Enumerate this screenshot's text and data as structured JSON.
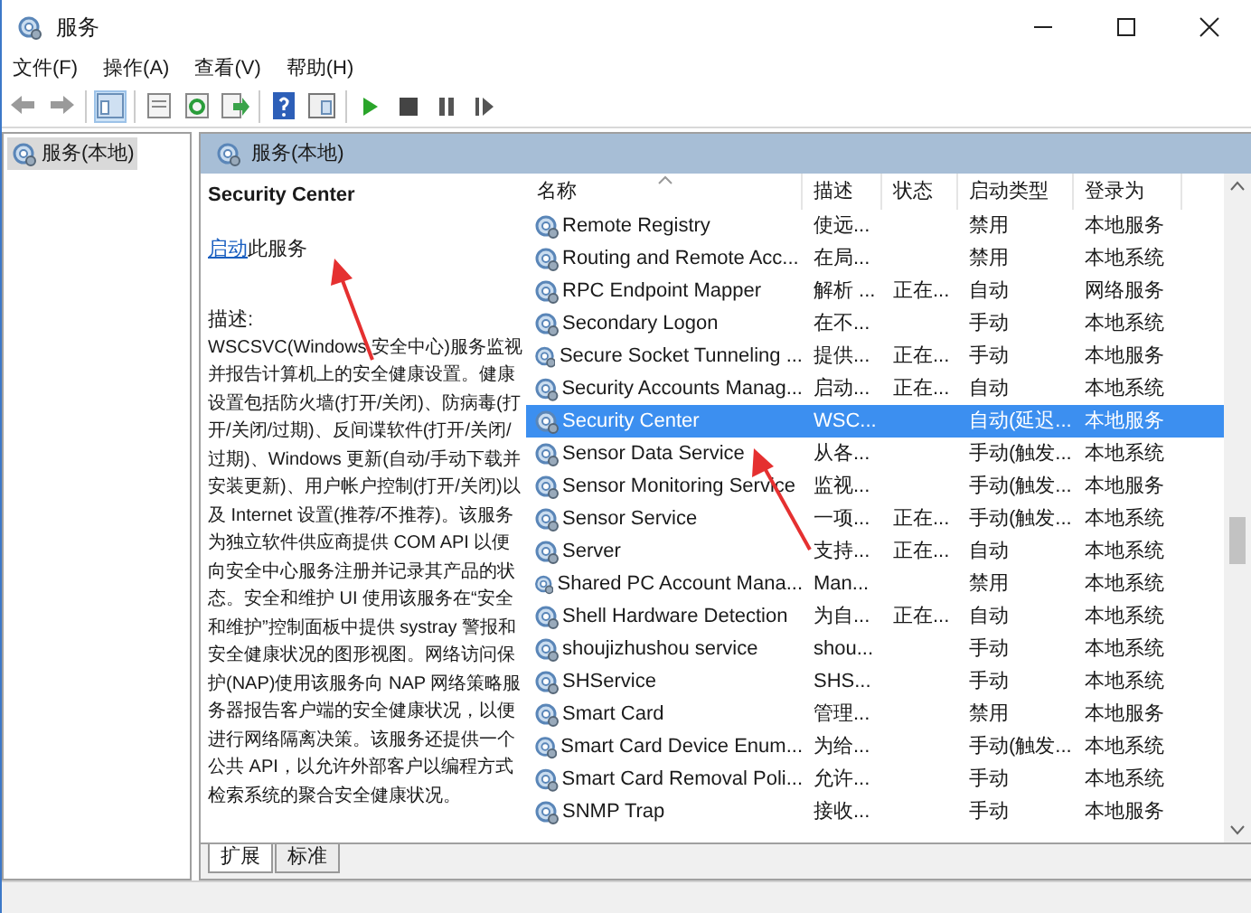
{
  "window": {
    "title": "服务"
  },
  "menu": [
    "文件(F)",
    "操作(A)",
    "查看(V)",
    "帮助(H)"
  ],
  "tree": {
    "items": [
      {
        "label": "服务(本地)",
        "selected": true
      }
    ]
  },
  "panel_header": "服务(本地)",
  "detail": {
    "title": "Security Center",
    "action_link": "启动",
    "action_text": "此服务",
    "description_label": "描述:",
    "description": "WSCSVC(Windows 安全中心)服务监视并报告计算机上的安全健康设置。健康设置包括防火墙(打开/关闭)、防病毒(打开/关闭/过期)、反间谍软件(打开/关闭/过期)、Windows 更新(自动/手动下载并安装更新)、用户帐户控制(打开/关闭)以及 Internet 设置(推荐/不推荐)。该服务为独立软件供应商提供 COM API 以便向安全中心服务注册并记录其产品的状态。安全和维护 UI 使用该服务在“安全和维护”控制面板中提供 systray 警报和安全健康状况的图形视图。网络访问保护(NAP)使用该服务向 NAP 网络策略服务器报告客户端的安全健康状况，以便进行网络隔离决策。该服务还提供一个公共 API，以允许外部客户以编程方式检索系统的聚合安全健康状况。"
  },
  "table": {
    "columns": [
      "名称",
      "描述",
      "状态",
      "启动类型",
      "登录为"
    ],
    "rows": [
      {
        "name": "Remote Registry",
        "desc": "使远...",
        "status": "",
        "startup": "禁用",
        "logon": "本地服务",
        "selected": false
      },
      {
        "name": "Routing and Remote Acc...",
        "desc": "在局...",
        "status": "",
        "startup": "禁用",
        "logon": "本地系统",
        "selected": false
      },
      {
        "name": "RPC Endpoint Mapper",
        "desc": "解析 ...",
        "status": "正在...",
        "startup": "自动",
        "logon": "网络服务",
        "selected": false
      },
      {
        "name": "Secondary Logon",
        "desc": "在不...",
        "status": "",
        "startup": "手动",
        "logon": "本地系统",
        "selected": false
      },
      {
        "name": "Secure Socket Tunneling ...",
        "desc": "提供...",
        "status": "正在...",
        "startup": "手动",
        "logon": "本地服务",
        "selected": false
      },
      {
        "name": "Security Accounts Manag...",
        "desc": "启动...",
        "status": "正在...",
        "startup": "自动",
        "logon": "本地系统",
        "selected": false
      },
      {
        "name": "Security Center",
        "desc": "WSC...",
        "status": "",
        "startup": "自动(延迟...",
        "logon": "本地服务",
        "selected": true
      },
      {
        "name": "Sensor Data Service",
        "desc": "从各...",
        "status": "",
        "startup": "手动(触发...",
        "logon": "本地系统",
        "selected": false
      },
      {
        "name": "Sensor Monitoring Service",
        "desc": "监视...",
        "status": "",
        "startup": "手动(触发...",
        "logon": "本地服务",
        "selected": false
      },
      {
        "name": "Sensor Service",
        "desc": "一项...",
        "status": "正在...",
        "startup": "手动(触发...",
        "logon": "本地系统",
        "selected": false
      },
      {
        "name": "Server",
        "desc": "支持...",
        "status": "正在...",
        "startup": "自动",
        "logon": "本地系统",
        "selected": false
      },
      {
        "name": "Shared PC Account Mana...",
        "desc": "Man...",
        "status": "",
        "startup": "禁用",
        "logon": "本地系统",
        "selected": false
      },
      {
        "name": "Shell Hardware Detection",
        "desc": "为自...",
        "status": "正在...",
        "startup": "自动",
        "logon": "本地系统",
        "selected": false
      },
      {
        "name": "shoujizhushou service",
        "desc": "shou...",
        "status": "",
        "startup": "手动",
        "logon": "本地系统",
        "selected": false
      },
      {
        "name": "SHService",
        "desc": "SHS...",
        "status": "",
        "startup": "手动",
        "logon": "本地系统",
        "selected": false
      },
      {
        "name": "Smart Card",
        "desc": "管理...",
        "status": "",
        "startup": "禁用",
        "logon": "本地服务",
        "selected": false
      },
      {
        "name": "Smart Card Device Enum...",
        "desc": "为给...",
        "status": "",
        "startup": "手动(触发...",
        "logon": "本地系统",
        "selected": false
      },
      {
        "name": "Smart Card Removal Poli...",
        "desc": "允许...",
        "status": "",
        "startup": "手动",
        "logon": "本地系统",
        "selected": false
      },
      {
        "name": "SNMP Trap",
        "desc": "接收...",
        "status": "",
        "startup": "手动",
        "logon": "本地服务",
        "selected": false
      }
    ]
  },
  "bottom_tabs": [
    {
      "label": "扩展",
      "selected": true
    },
    {
      "label": "标准",
      "selected": false
    }
  ]
}
